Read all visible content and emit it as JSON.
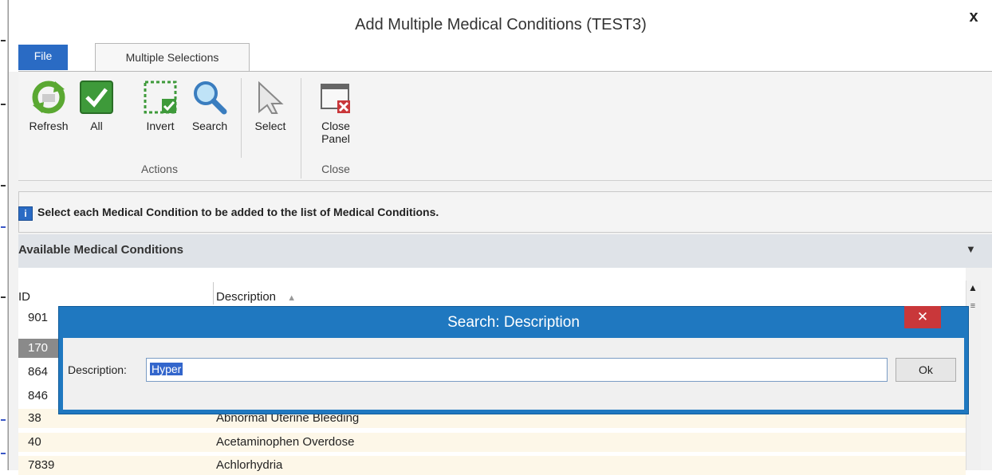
{
  "window": {
    "title": "Add Multiple Medical Conditions (TEST3)",
    "close_glyph": "x"
  },
  "ribbon": {
    "tabs": [
      {
        "label": "File"
      },
      {
        "label": "Multiple Selections"
      }
    ],
    "buttons": {
      "refresh": {
        "label": "Refresh",
        "icon": "refresh-icon"
      },
      "all": {
        "label": "All",
        "icon": "checkmark-icon"
      },
      "invert": {
        "label": "Invert",
        "icon": "invert-selection-icon"
      },
      "search": {
        "label": "Search",
        "icon": "magnifier-icon"
      },
      "select": {
        "label": "Select",
        "icon": "cursor-arrow-icon"
      },
      "close_panel": {
        "label1": "Close",
        "label2": "Panel",
        "icon": "close-panel-icon"
      }
    },
    "groups": {
      "actions": "Actions",
      "close": "Close"
    }
  },
  "info": {
    "text": "Select each Medical Condition to be added to the list of Medical Conditions."
  },
  "available": {
    "title": "Available Medical Conditions"
  },
  "grid": {
    "columns": {
      "id": "ID",
      "description": "Description"
    },
    "rows": [
      {
        "id": "901",
        "description": ""
      },
      {
        "id": "170",
        "description": ""
      },
      {
        "id": "864",
        "description": ""
      },
      {
        "id": "846",
        "description": ""
      },
      {
        "id": "38",
        "description": "Abnormal Uterine Bleeding"
      },
      {
        "id": "40",
        "description": "Acetaminophen Overdose"
      },
      {
        "id": "7839",
        "description": "Achlorhydria"
      }
    ]
  },
  "dialog": {
    "title": "Search: Description",
    "close_glyph": "✕",
    "label": "Description:",
    "value": "Hyper",
    "ok_label": "Ok"
  },
  "colors": {
    "accent": "#1f78c0",
    "file_tab": "#2a6bc4",
    "dialog_close": "#c9373a",
    "row_cream": "#fdf7e8",
    "row_selected": "#8a8a8a"
  }
}
